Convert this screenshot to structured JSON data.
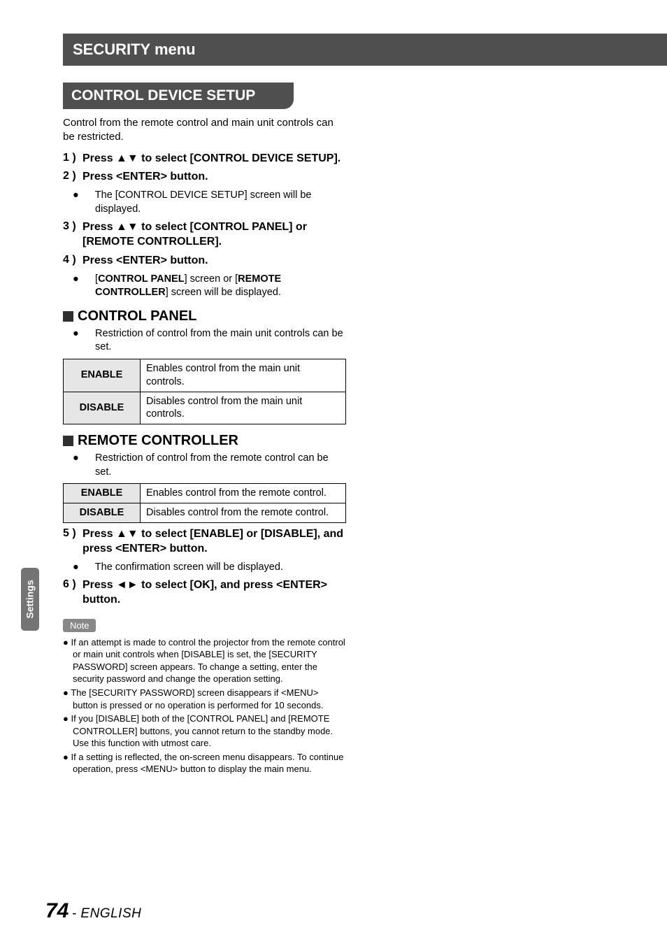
{
  "page": {
    "number": "74",
    "language_label": "- ENGLISH"
  },
  "top_band_title": "SECURITY menu",
  "side_tab_label": "Settings",
  "section_title": "CONTROL DEVICE SETUP",
  "intro": "Control from the remote control and main unit controls can be restricted.",
  "steps": {
    "s1_num": "1 )",
    "s1": "Press ▲▼ to select [CONTROL DEVICE SETUP].",
    "s2_num": "2 )",
    "s2": "Press <ENTER> button.",
    "s2_sub": "The [CONTROL DEVICE SETUP] screen will be displayed.",
    "s3_num": "3 )",
    "s3": "Press ▲▼ to select [CONTROL PANEL] or [REMOTE CONTROLLER].",
    "s4_num": "4 )",
    "s4": "Press <ENTER> button.",
    "s4_sub_prefix": "[",
    "s4_sub_b1": "CONTROL PANEL",
    "s4_sub_mid": "] screen or [",
    "s4_sub_b2": "REMOTE CONTROLLER",
    "s4_sub_suffix": "] screen will be displayed.",
    "s5_num": "5 )",
    "s5": "Press ▲▼ to select [ENABLE] or [DISABLE], and press <ENTER> button.",
    "s5_sub": "The confirmation screen will be displayed.",
    "s6_num": "6 )",
    "s6": "Press ◄► to select [OK], and press <ENTER> button."
  },
  "control_panel": {
    "heading": "CONTROL PANEL",
    "desc": "Restriction of control from the main unit controls can be set.",
    "rows": [
      {
        "key": "ENABLE",
        "val": "Enables control from the main unit controls."
      },
      {
        "key": "DISABLE",
        "val": "Disables control from the main unit controls."
      }
    ]
  },
  "remote_controller": {
    "heading": "REMOTE CONTROLLER",
    "desc": "Restriction of control from the remote control can be set.",
    "rows": [
      {
        "key": "ENABLE",
        "val": "Enables control from the remote control."
      },
      {
        "key": "DISABLE",
        "val": "Disables control from the remote control."
      }
    ]
  },
  "note": {
    "label": "Note",
    "items": [
      "If an attempt is made to control the projector from the remote control or main unit controls when [DISABLE] is set, the [SECURITY PASSWORD] screen appears. To change a setting, enter the security password and change the operation setting.",
      "The [SECURITY PASSWORD] screen disappears if <MENU> button is pressed or no operation is performed for 10 seconds.",
      "If you [DISABLE] both of the [CONTROL PANEL] and [REMOTE CONTROLLER] buttons, you cannot return to the standby mode. Use this function with utmost care.",
      "If a setting is reflected, the on-screen menu disappears. To continue operation, press <MENU> button to display the main menu."
    ]
  }
}
